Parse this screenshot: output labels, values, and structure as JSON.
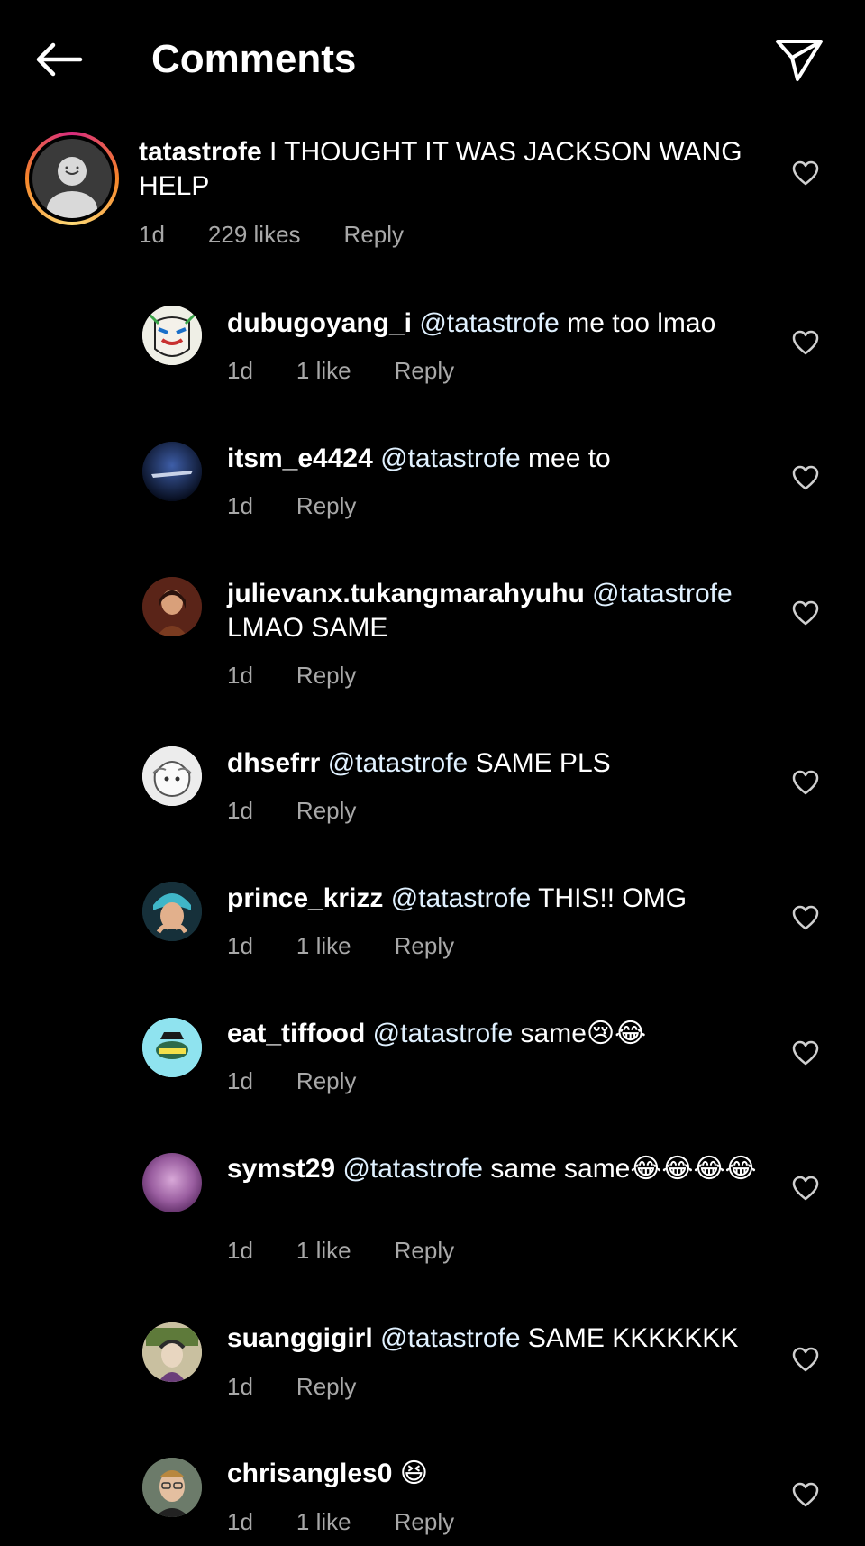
{
  "header": {
    "title": "Comments",
    "back_icon": "arrow-left-icon",
    "share_icon": "paper-plane-icon"
  },
  "main_comment": {
    "username": "tatastrofe",
    "text": "I THOUGHT IT WAS JACKSON WANG HELP",
    "time": "1d",
    "likes": "229 likes",
    "reply": "Reply"
  },
  "replies": [
    {
      "username": "dubugoyang_i",
      "mention": "@tatastrofe",
      "text": "me too lmao",
      "time": "1d",
      "likes": "1 like",
      "reply": "Reply"
    },
    {
      "username": "itsm_e4424",
      "mention": "@tatastrofe",
      "text": "mee to",
      "time": "1d",
      "likes": "",
      "reply": "Reply"
    },
    {
      "username": "julievanx.tukangmarahyuhu",
      "mention": "@tatastrofe",
      "text": "LMAO SAME",
      "time": "1d",
      "likes": "",
      "reply": "Reply"
    },
    {
      "username": "dhsefrr",
      "mention": "@tatastrofe",
      "text": "SAME PLS",
      "time": "1d",
      "likes": "",
      "reply": "Reply"
    },
    {
      "username": "prince_krizz",
      "mention": "@tatastrofe",
      "text": "THIS!! OMG",
      "time": "1d",
      "likes": "1 like",
      "reply": "Reply"
    },
    {
      "username": "eat_tiffood",
      "mention": "@tatastrofe",
      "text": "same😢😂",
      "time": "1d",
      "likes": "",
      "reply": "Reply"
    },
    {
      "username": "symst29",
      "mention": "@tatastrofe",
      "text": "same same😂😂😂😂",
      "time": "1d",
      "likes": "1 like",
      "reply": "Reply"
    },
    {
      "username": "suanggigirl",
      "mention": "@tatastrofe",
      "text": "SAME KKKKKKK",
      "time": "1d",
      "likes": "",
      "reply": "Reply"
    },
    {
      "username": "chrisangles0",
      "mention": "",
      "text": "😆",
      "time": "1d",
      "likes": "1 like",
      "reply": "Reply"
    }
  ],
  "colors": {
    "background": "#000000",
    "text": "#ffffff",
    "meta": "#a8a8a8",
    "mention": "#e0f1ff"
  }
}
